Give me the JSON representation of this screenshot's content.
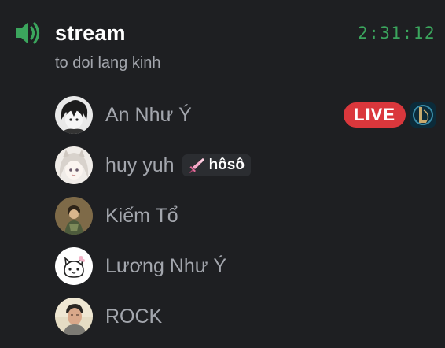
{
  "channel": {
    "icon": "speaker-icon",
    "name": "stream",
    "timer": "2:31:12",
    "status": "to doi lang kinh"
  },
  "members": [
    {
      "name": "An Như Ý",
      "avatar": "anime-boy-avatar",
      "live_label": "LIVE",
      "game_icon": "league-of-legends-icon"
    },
    {
      "name": "huy yuh",
      "avatar": "anime-girl-avatar",
      "tag": {
        "icon": "pink-sword-icon",
        "text": "hôsô"
      }
    },
    {
      "name": "Kiếm Tổ",
      "avatar": "character-photo-avatar"
    },
    {
      "name": "Lương Như Ý",
      "avatar": "cartoon-cat-avatar"
    },
    {
      "name": "ROCK",
      "avatar": "man-photo-avatar"
    }
  ],
  "colors": {
    "background": "#1e1f22",
    "accent_green": "#3ba55d",
    "live_red": "#da373c",
    "name_gray": "#a3a6ad"
  }
}
